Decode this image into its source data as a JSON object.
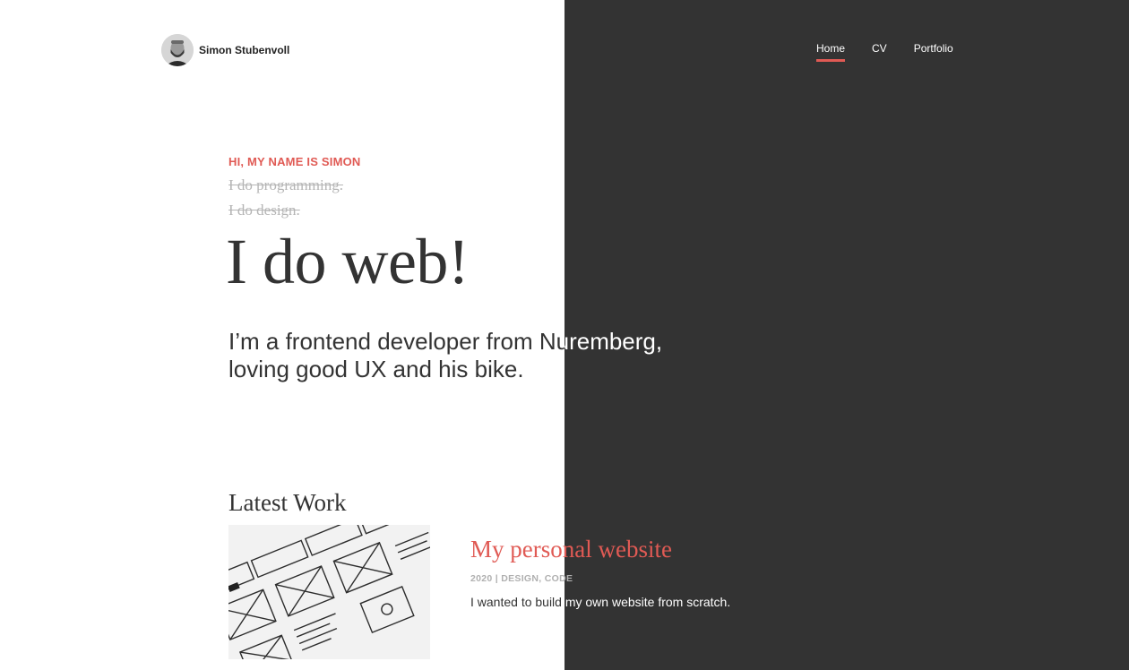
{
  "brand": {
    "name": "Simon Stubenvoll",
    "avatar_icon": "avatar-photo"
  },
  "nav": {
    "items": [
      {
        "label": "Home",
        "active": true
      },
      {
        "label": "CV",
        "active": false
      },
      {
        "label": "Portfolio",
        "active": false
      }
    ]
  },
  "hero": {
    "intro": "HI, MY NAME IS SIMON",
    "struck_lines": [
      "I do programming.",
      "I do design."
    ],
    "headline": "I do web!",
    "tagline_line1": "I’m a frontend developer from Nuremberg,",
    "tagline_line2": "loving good UX and his bike."
  },
  "latest_work": {
    "title": "Latest Work",
    "items": [
      {
        "title": "My personal website",
        "meta": "2020 | DESIGN, CODE",
        "description": "I wanted to build my own website from scratch.",
        "thumbnail_icon": "wireframe-sketch-image"
      }
    ]
  },
  "colors": {
    "accent": "#e05a54",
    "dark_panel": "#333333",
    "light_bg": "#ffffff"
  }
}
